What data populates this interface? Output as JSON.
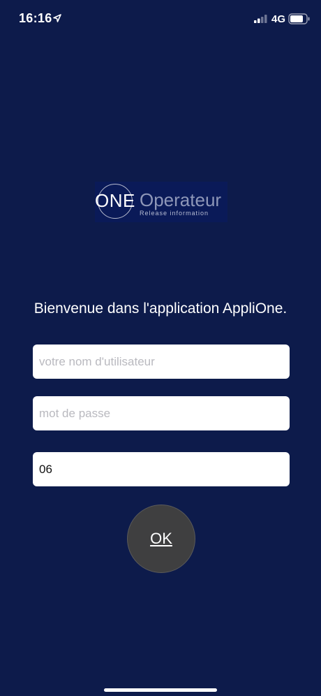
{
  "status_bar": {
    "time": "16:16",
    "network": "4G"
  },
  "logo": {
    "one": "ONE",
    "operateur": "Operateur",
    "release": "Release information"
  },
  "welcome": "Bienvenue dans l'application AppliOne.",
  "form": {
    "username_placeholder": "votre nom d'utilisateur",
    "username_value": "",
    "password_placeholder": "mot de passe",
    "password_value": "",
    "code_value": "06",
    "ok_label": "OK"
  },
  "colors": {
    "background": "#0d1b4b",
    "button": "#3f3f40"
  },
  "icons": {
    "location": "location-arrow-icon",
    "signal": "signal-bars-icon",
    "battery": "battery-icon"
  }
}
